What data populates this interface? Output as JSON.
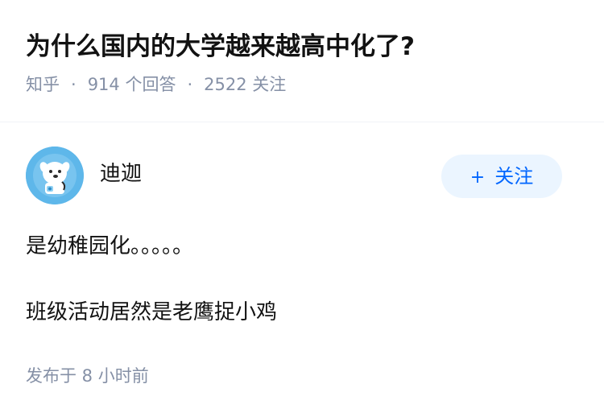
{
  "question": {
    "title": "为什么国内的大学越来越高中化了?",
    "source": "知乎",
    "separator": "·",
    "answers": "914 个回答",
    "followers": "2522 关注"
  },
  "author": {
    "name": "迪迦",
    "avatar_icon": "cartoon-dog-astronaut-avatar",
    "follow_plus": "+",
    "follow_label": "关注"
  },
  "answer": {
    "paragraphs": [
      "是幼稚园化。。。。。",
      "班级活动居然是老鹰捉小鸡"
    ],
    "published": "发布于 8 小时前"
  },
  "colors": {
    "meta_text": "#8590a6",
    "follow_bg": "#ebf5ff",
    "follow_text": "#0066ff",
    "avatar_bg": "#5eb7ea"
  }
}
